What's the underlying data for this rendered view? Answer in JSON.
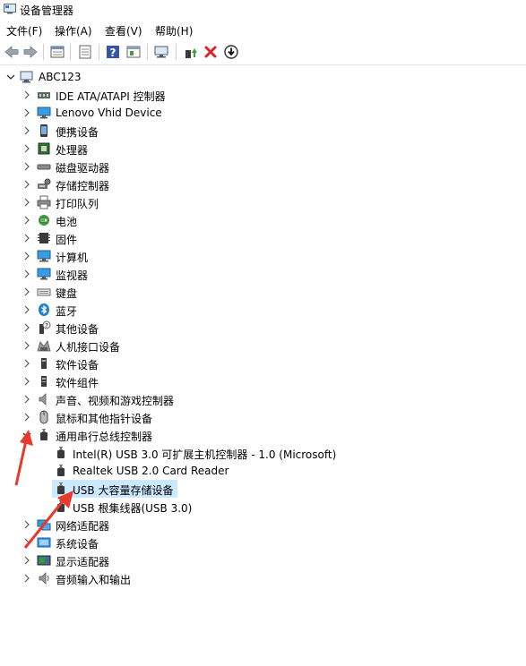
{
  "window": {
    "title": "设备管理器"
  },
  "menu": [
    {
      "id": "file",
      "label": "文件(F)"
    },
    {
      "id": "action",
      "label": "操作(A)"
    },
    {
      "id": "view",
      "label": "查看(V)"
    },
    {
      "id": "help",
      "label": "帮助(H)"
    }
  ],
  "toolbar": {
    "icons": [
      "back-icon",
      "forward-icon",
      "properties-icon",
      "list-icon",
      "help-icon",
      "details-icon",
      "scan-monitor-icon",
      "update-driver-icon",
      "uninstall-icon",
      "download-icon"
    ]
  },
  "tree": {
    "root": "ABC123",
    "categories": [
      {
        "label": "IDE ATA/ATAPI 控制器",
        "icon": "ide-controller-icon"
      },
      {
        "label": "Lenovo Vhid Device",
        "icon": "monitor-icon"
      },
      {
        "label": "便携设备",
        "icon": "portable-device-icon"
      },
      {
        "label": "处理器",
        "icon": "processor-icon"
      },
      {
        "label": "磁盘驱动器",
        "icon": "disk-drive-icon"
      },
      {
        "label": "存储控制器",
        "icon": "storage-controller-icon"
      },
      {
        "label": "打印队列",
        "icon": "printer-icon"
      },
      {
        "label": "电池",
        "icon": "battery-icon"
      },
      {
        "label": "固件",
        "icon": "firmware-icon"
      },
      {
        "label": "计算机",
        "icon": "computer-icon"
      },
      {
        "label": "监视器",
        "icon": "monitor-icon"
      },
      {
        "label": "键盘",
        "icon": "keyboard-icon"
      },
      {
        "label": "蓝牙",
        "icon": "bluetooth-icon"
      },
      {
        "label": "其他设备",
        "icon": "other-device-icon"
      },
      {
        "label": "人机接口设备",
        "icon": "hid-icon"
      },
      {
        "label": "软件设备",
        "icon": "software-device-icon"
      },
      {
        "label": "软件组件",
        "icon": "software-component-icon"
      },
      {
        "label": "声音、视频和游戏控制器",
        "icon": "speaker-icon"
      },
      {
        "label": "鼠标和其他指针设备",
        "icon": "mouse-icon"
      },
      {
        "label": "通用串行总线控制器",
        "icon": "usb-icon",
        "expanded": true,
        "children": [
          {
            "label": "Intel(R) USB 3.0 可扩展主机控制器 - 1.0 (Microsoft)",
            "icon": "usb-icon"
          },
          {
            "label": "Realtek USB 2.0 Card Reader",
            "icon": "usb-icon"
          },
          {
            "label": "USB 大容量存储设备",
            "icon": "usb-icon",
            "selected": true
          },
          {
            "label": "USB 根集线器(USB 3.0)",
            "icon": "usb-icon"
          }
        ]
      },
      {
        "label": "网络适配器",
        "icon": "network-adapter-icon"
      },
      {
        "label": "系统设备",
        "icon": "system-device-icon"
      },
      {
        "label": "显示适配器",
        "icon": "display-adapter-icon"
      },
      {
        "label": "音频输入和输出",
        "icon": "audio-io-icon"
      }
    ]
  },
  "colors": {
    "selection": "#cce8ff",
    "annotation_arrow": "#e8392c",
    "accent": "#1b7fd6"
  }
}
